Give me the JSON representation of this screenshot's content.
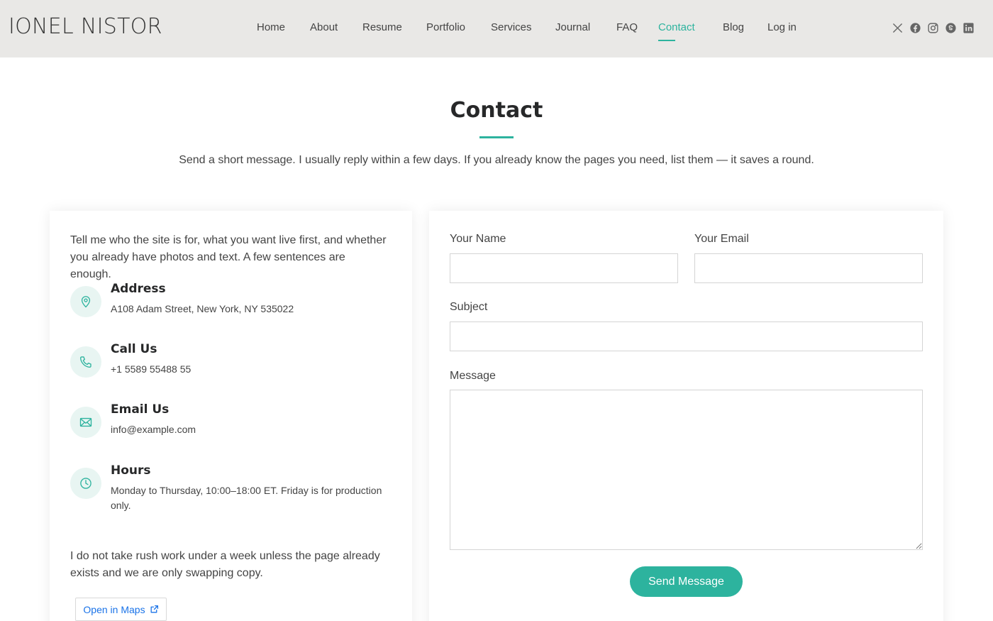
{
  "header": {
    "logo": "IONEL NISTOR",
    "nav": [
      {
        "label": "Home",
        "active": false
      },
      {
        "label": "About",
        "active": false
      },
      {
        "label": "Resume",
        "active": false
      },
      {
        "label": "Portfolio",
        "active": false
      },
      {
        "label": "Services",
        "active": false
      },
      {
        "label": "Journal",
        "active": false
      },
      {
        "label": "FAQ",
        "active": false
      },
      {
        "label": "Contact",
        "active": true
      },
      {
        "label": "Blog",
        "active": false
      },
      {
        "label": "Log in",
        "active": false
      }
    ],
    "social": [
      "x-icon",
      "facebook-icon",
      "instagram-icon",
      "skype-icon",
      "linkedin-icon"
    ]
  },
  "page": {
    "title": "Contact",
    "subtitle": "Send a short message. I usually reply within a few days. If you already know the pages you need, list them — it saves a round."
  },
  "info": {
    "intro": "Tell me who the site is for, what you want live first, and whether you already have photos and text. A few sentences are enough.",
    "items": [
      {
        "icon": "map-pin-icon",
        "title": "Address",
        "text": "A108 Adam Street, New York, NY 535022"
      },
      {
        "icon": "phone-icon",
        "title": "Call Us",
        "text": "+1 5589 55488 55"
      },
      {
        "icon": "envelope-icon",
        "title": "Email Us",
        "text": "info@example.com"
      },
      {
        "icon": "clock-icon",
        "title": "Hours",
        "text": "Monday to Thursday, 10:00–18:00 ET. Friday is for production only."
      }
    ],
    "note": "I do not take rush work under a week unless the page already exists and we are only swapping copy.",
    "maps_label": "Open in Maps"
  },
  "form": {
    "name_label": "Your Name",
    "name_value": "",
    "email_label": "Your Email",
    "email_value": "",
    "subject_label": "Subject",
    "subject_value": "",
    "message_label": "Message",
    "message_value": "",
    "submit_label": "Send Message"
  },
  "colors": {
    "accent": "#2db39e",
    "header_bg": "#e9e8e6",
    "link": "#1a73e8"
  }
}
